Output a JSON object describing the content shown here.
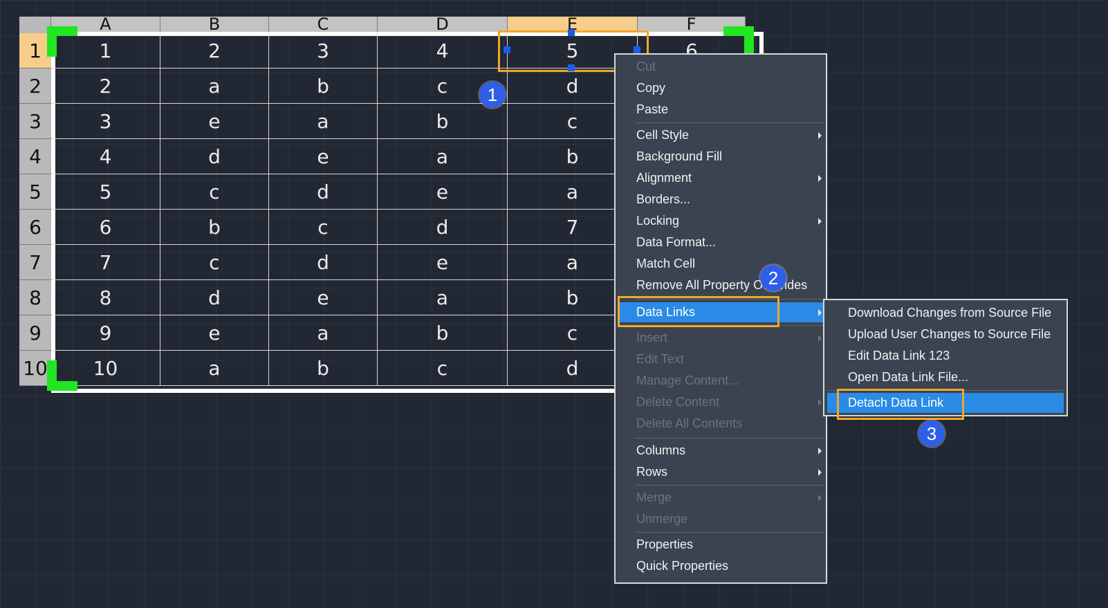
{
  "table": {
    "columns": [
      "A",
      "B",
      "C",
      "D",
      "E",
      "F"
    ],
    "rows": [
      "1",
      "2",
      "3",
      "4",
      "5",
      "6",
      "7",
      "8",
      "9",
      "10"
    ],
    "cells": [
      [
        "1",
        "2",
        "3",
        "4",
        "5",
        "6"
      ],
      [
        "2",
        "a",
        "b",
        "c",
        "d",
        ""
      ],
      [
        "3",
        "e",
        "a",
        "b",
        "c",
        ""
      ],
      [
        "4",
        "d",
        "e",
        "a",
        "b",
        ""
      ],
      [
        "5",
        "c",
        "d",
        "e",
        "a",
        ""
      ],
      [
        "6",
        "b",
        "c",
        "d",
        "7",
        ""
      ],
      [
        "7",
        "c",
        "d",
        "e",
        "a",
        ""
      ],
      [
        "8",
        "d",
        "e",
        "a",
        "b",
        ""
      ],
      [
        "9",
        "e",
        "a",
        "b",
        "c",
        ""
      ],
      [
        "10",
        "a",
        "b",
        "c",
        "d",
        ""
      ]
    ],
    "selected_cell": "E1"
  },
  "context_menu": {
    "items": [
      {
        "label": "Cut",
        "enabled": false,
        "submenu": false
      },
      {
        "label": "Copy",
        "enabled": true,
        "submenu": false
      },
      {
        "label": "Paste",
        "enabled": true,
        "submenu": false
      },
      {
        "label": "Cell Style",
        "enabled": true,
        "submenu": true
      },
      {
        "label": "Background Fill",
        "enabled": true,
        "submenu": false
      },
      {
        "label": "Alignment",
        "enabled": true,
        "submenu": true
      },
      {
        "label": "Borders...",
        "enabled": true,
        "submenu": false
      },
      {
        "label": "Locking",
        "enabled": true,
        "submenu": true
      },
      {
        "label": "Data Format...",
        "enabled": true,
        "submenu": false
      },
      {
        "label": "Match Cell",
        "enabled": true,
        "submenu": false
      },
      {
        "label": "Remove All Property Overrides",
        "enabled": true,
        "submenu": false
      },
      {
        "label": "Data Links",
        "enabled": true,
        "submenu": true,
        "highlighted": true
      },
      {
        "label": "Insert",
        "enabled": false,
        "submenu": true
      },
      {
        "label": "Edit Text",
        "enabled": false,
        "submenu": false
      },
      {
        "label": "Manage Content...",
        "enabled": false,
        "submenu": false
      },
      {
        "label": "Delete Content",
        "enabled": false,
        "submenu": true
      },
      {
        "label": "Delete All Contents",
        "enabled": false,
        "submenu": false
      },
      {
        "label": "Columns",
        "enabled": true,
        "submenu": true
      },
      {
        "label": "Rows",
        "enabled": true,
        "submenu": true
      },
      {
        "label": "Merge",
        "enabled": false,
        "submenu": true
      },
      {
        "label": "Unmerge",
        "enabled": false,
        "submenu": false
      },
      {
        "label": "Properties",
        "enabled": true,
        "submenu": false
      },
      {
        "label": "Quick Properties",
        "enabled": true,
        "submenu": false
      }
    ]
  },
  "data_links_submenu": {
    "items": [
      {
        "label": "Download Changes from Source File",
        "enabled": true
      },
      {
        "label": "Upload User Changes to Source File",
        "enabled": true
      },
      {
        "label": "Edit Data Link 123",
        "enabled": true
      },
      {
        "label": "Open Data Link File...",
        "enabled": true
      },
      {
        "label": "Detach Data Link",
        "enabled": true,
        "highlighted": true
      }
    ]
  },
  "annotations": {
    "step1": "1",
    "step2": "2",
    "step3": "3"
  },
  "colors": {
    "background": "#222833",
    "highlight": "#2a8be6",
    "callout": "#f1a82b",
    "badge": "#2f5fe8",
    "grip": "#22e622"
  }
}
